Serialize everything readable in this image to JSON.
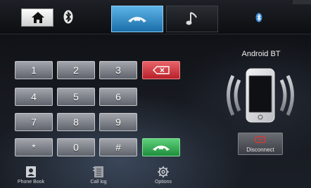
{
  "dialpad": {
    "keys": [
      "1",
      "2",
      "3",
      "4",
      "5",
      "6",
      "7",
      "8",
      "9",
      "*",
      "0",
      "#"
    ]
  },
  "device": {
    "name": "Android BT",
    "disconnect_label": "Disconnect"
  },
  "bottom_nav": {
    "phonebook_label": "Phone Book",
    "calllog_label": "Call log",
    "options_label": "Options"
  },
  "colors": {
    "active_tab": "#3a93cf",
    "backspace": "#c9323b",
    "call": "#2fa84f",
    "disconnect_icon": "#d23a3a"
  },
  "icons": {
    "home": "home-icon",
    "bluetooth": "bluetooth-icon",
    "phone": "phone-handset-icon",
    "music": "music-note-icon",
    "backspace": "backspace-icon",
    "call": "call-icon",
    "phonebook": "phonebook-icon",
    "calllog": "call-log-icon",
    "options": "gear-icon"
  }
}
